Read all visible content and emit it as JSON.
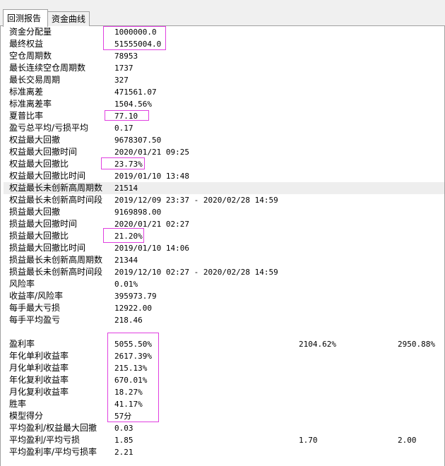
{
  "tabs": [
    {
      "label": "回测报告",
      "active": true
    },
    {
      "label": "资金曲线",
      "active": false
    }
  ],
  "accent_color": "#e040e0",
  "rows": [
    {
      "label": "资金分配量",
      "v1": "1000000.0"
    },
    {
      "label": "最终权益",
      "v1": "51555004.0"
    },
    {
      "label": "空仓周期数",
      "v1": "78953"
    },
    {
      "label": "最长连续空仓周期数",
      "v1": "1737"
    },
    {
      "label": "最长交易周期",
      "v1": "327"
    },
    {
      "label": "标准离差",
      "v1": "471561.07"
    },
    {
      "label": "标准离差率",
      "v1": "1504.56%"
    },
    {
      "label": "夏普比率",
      "v1": "77.10"
    },
    {
      "label": "盈亏总平均/亏损平均",
      "v1": "0.17"
    },
    {
      "label": "权益最大回撤",
      "v1": "9678307.50"
    },
    {
      "label": "权益最大回撤时间",
      "v1": "2020/01/21 09:25"
    },
    {
      "label": "权益最大回撤比",
      "v1": "23.73%"
    },
    {
      "label": "权益最大回撤比时间",
      "v1": "2019/01/10 13:48"
    },
    {
      "label": "权益最长未创新高周期数",
      "v1": "21514"
    },
    {
      "label": "权益最长未创新高时间段",
      "v1": "2019/12/09 23:37 - 2020/02/28 14:59"
    },
    {
      "label": "损益最大回撤",
      "v1": "9169898.00"
    },
    {
      "label": "损益最大回撤时间",
      "v1": "2020/01/21 02:27"
    },
    {
      "label": "损益最大回撤比",
      "v1": "21.20%"
    },
    {
      "label": "损益最大回撤比时间",
      "v1": "2019/01/10 14:06"
    },
    {
      "label": "损益最长未创新高周期数",
      "v1": "21344"
    },
    {
      "label": "损益最长未创新高时间段",
      "v1": "2019/12/10 02:27 - 2020/02/28 14:59"
    },
    {
      "label": "风险率",
      "v1": "0.01%"
    },
    {
      "label": "收益率/风险率",
      "v1": "395973.79"
    },
    {
      "label": "每手最大亏损",
      "v1": "12922.00"
    },
    {
      "label": "每手平均盈亏",
      "v1": "218.46"
    },
    {
      "label": "",
      "v1": ""
    },
    {
      "label": "盈利率",
      "v1": "5055.50%",
      "v2": "2104.62%",
      "v3": "2950.88%"
    },
    {
      "label": "年化单利收益率",
      "v1": "2617.39%"
    },
    {
      "label": "月化单利收益率",
      "v1": "215.13%"
    },
    {
      "label": "年化复利收益率",
      "v1": "670.01%"
    },
    {
      "label": "月化复利收益率",
      "v1": "18.27%"
    },
    {
      "label": "胜率",
      "v1": "41.17%"
    },
    {
      "label": "模型得分",
      "v1": "57分"
    },
    {
      "label": "平均盈利/权益最大回撤",
      "v1": "0.03"
    },
    {
      "label": "平均盈利/平均亏损",
      "v1": "1.85",
      "v2": "1.70",
      "v3": "2.00"
    },
    {
      "label": "平均盈利率/平均亏损率",
      "v1": "2.21"
    }
  ]
}
